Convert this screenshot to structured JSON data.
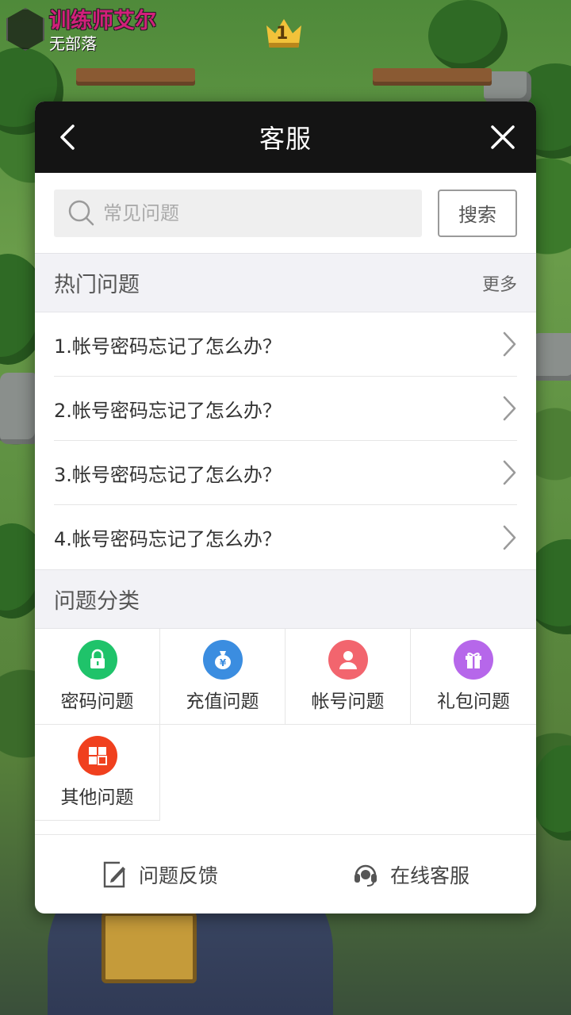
{
  "hud": {
    "player_name": "训练师艾尔",
    "clan_name": "无部落",
    "crown_count": "1"
  },
  "dialog": {
    "title": "客服",
    "back_icon": "chevron-left-icon",
    "close_icon": "close-icon"
  },
  "search": {
    "placeholder": "常见问题",
    "value": "",
    "button_label": "搜索"
  },
  "hot_questions": {
    "title": "热门问题",
    "more_label": "更多",
    "items": [
      {
        "label": "1.帐号密码忘记了怎么办？"
      },
      {
        "label": "2.帐号密码忘记了怎么办？"
      },
      {
        "label": "3.帐号密码忘记了怎么办？"
      },
      {
        "label": "4.帐号密码忘记了怎么办？"
      }
    ]
  },
  "categories": {
    "title": "问题分类",
    "items": [
      {
        "label": "密码问题",
        "icon": "lock-icon",
        "color": "#1fc36a"
      },
      {
        "label": "充值问题",
        "icon": "money-bag-icon",
        "color": "#3b8de0"
      },
      {
        "label": "帐号问题",
        "icon": "user-icon",
        "color": "#f2656e"
      },
      {
        "label": "礼包问题",
        "icon": "gift-icon",
        "color": "#b667ea"
      },
      {
        "label": "其他问题",
        "icon": "grid-icon",
        "color": "#f0401e"
      }
    ]
  },
  "footer": {
    "feedback_label": "问题反馈",
    "feedback_icon": "edit-icon",
    "online_label": "在线客服",
    "online_icon": "headset-icon"
  }
}
